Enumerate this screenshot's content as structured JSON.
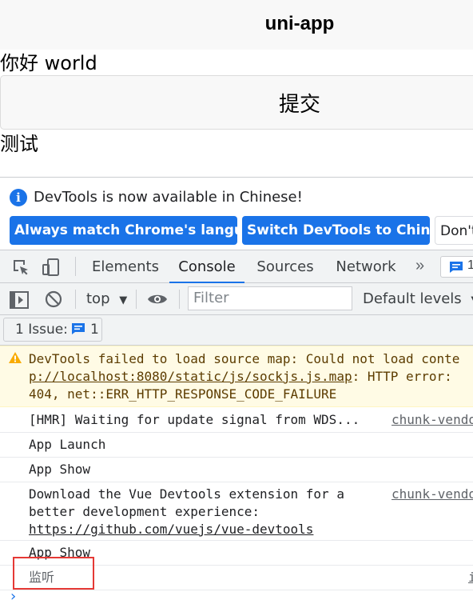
{
  "app": {
    "title": "uni-app",
    "greeting": "你好 world",
    "submit_label": "提交",
    "test_text": "测试"
  },
  "devtools": {
    "infobar": {
      "message": "DevTools is now available in Chinese!",
      "match_language_label": "Always match Chrome's language",
      "switch_label": "Switch DevTools to Chinese",
      "dont_label": "Don't"
    },
    "tabs": [
      "Elements",
      "Console",
      "Sources",
      "Network"
    ],
    "active_tab": "Console",
    "more_tabs_label": "»",
    "issues_chip_count": "1",
    "console_toolbar": {
      "context": "top",
      "filter_placeholder": "Filter",
      "levels": "Default levels"
    },
    "issues_button": {
      "label": "1 Issue:",
      "count": "1"
    },
    "messages": [
      {
        "type": "warning",
        "line1": "DevTools failed to load source map: Could not load conte",
        "line2_link": "p://localhost:8080/static/js/sockjs.js.map",
        "line2_rest": ": HTTP error:",
        "line3": "404, net::ERR_HTTP_RESPONSE_CODE_FAILURE"
      },
      {
        "type": "log",
        "text": "[HMR] Waiting for update signal from WDS...",
        "source": "chunk-vendo"
      },
      {
        "type": "log",
        "text": "App Launch"
      },
      {
        "type": "log",
        "text": "App Show"
      },
      {
        "type": "log",
        "line1": "Download the Vue Devtools extension for a",
        "line2": "better development experience:",
        "line3_link": "https://github.com/vuejs/vue-devtools",
        "source": "chunk-vendo"
      },
      {
        "type": "log",
        "text": "App Show"
      },
      {
        "type": "log",
        "text": "监听",
        "source": "i"
      }
    ],
    "colors": {
      "accent": "#1a73e8",
      "warning_bg": "#fffbe5",
      "highlight": "#e53935"
    }
  }
}
